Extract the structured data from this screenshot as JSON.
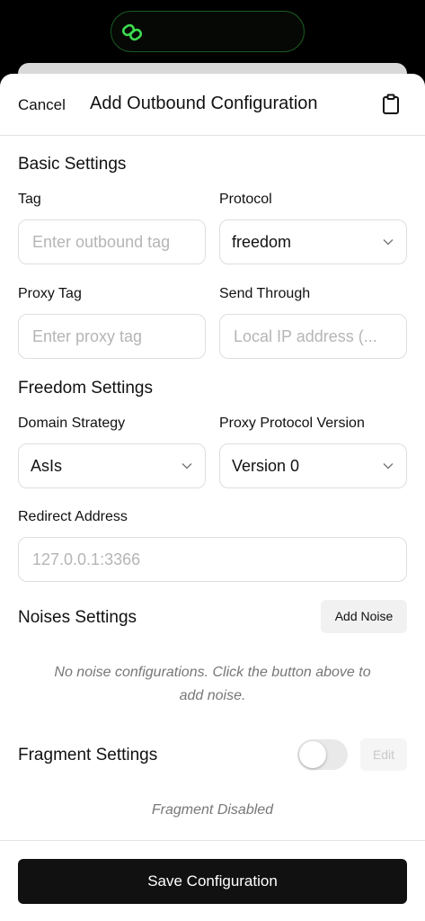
{
  "header": {
    "cancel_label": "Cancel",
    "title": "Add Outbound Configuration"
  },
  "basic": {
    "title": "Basic Settings",
    "tag_label": "Tag",
    "tag_placeholder": "Enter outbound tag",
    "protocol_label": "Protocol",
    "protocol_value": "freedom",
    "proxy_tag_label": "Proxy Tag",
    "proxy_tag_placeholder": "Enter proxy tag",
    "send_through_label": "Send Through",
    "send_through_placeholder": "Local IP address (..."
  },
  "freedom": {
    "title": "Freedom Settings",
    "domain_strategy_label": "Domain Strategy",
    "domain_strategy_value": "AsIs",
    "proxy_protocol_label": "Proxy Protocol Version",
    "proxy_protocol_value": "Version 0",
    "redirect_label": "Redirect Address",
    "redirect_placeholder": "127.0.0.1:3366"
  },
  "noises": {
    "title": "Noises Settings",
    "add_label": "Add Noise",
    "empty_line1": "No noise configurations. Click the button above to",
    "empty_line2": "add noise."
  },
  "fragment": {
    "title": "Fragment Settings",
    "enabled": false,
    "edit_label": "Edit",
    "status": "Fragment Disabled"
  },
  "footer": {
    "save_label": "Save Configuration"
  },
  "colors": {
    "island_accent": "#3ddc4f",
    "primary_button": "#111111"
  }
}
